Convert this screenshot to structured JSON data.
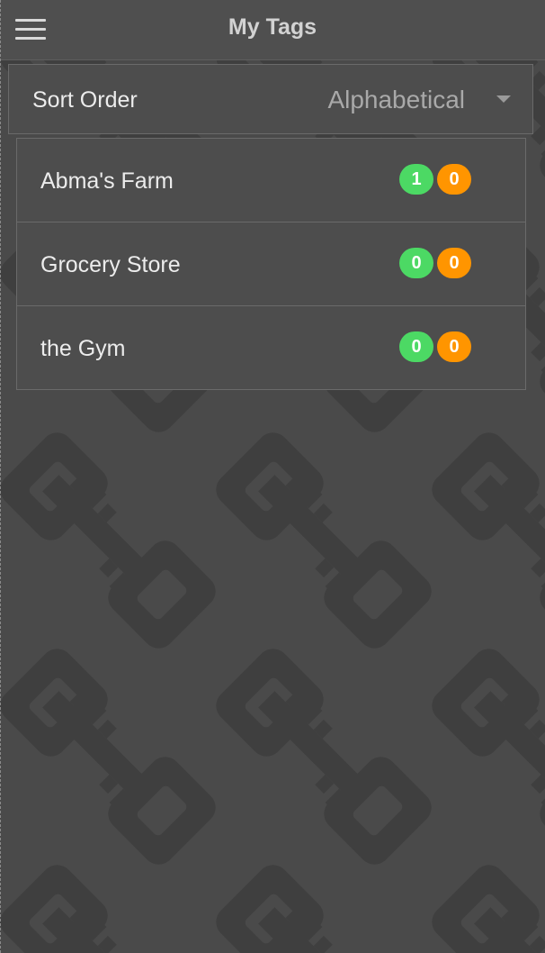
{
  "header": {
    "title": "My Tags",
    "menu_icon": "hamburger-menu-icon"
  },
  "sort": {
    "label": "Sort Order",
    "value": "Alphabetical",
    "icon": "dropdown-caret-icon"
  },
  "tags": [
    {
      "name": "Abma's Farm",
      "count_green": "1",
      "count_orange": "0"
    },
    {
      "name": "Grocery Store",
      "count_green": "0",
      "count_orange": "0"
    },
    {
      "name": "the Gym",
      "count_green": "0",
      "count_orange": "0"
    }
  ],
  "colors": {
    "badge_green": "#4cd964",
    "badge_orange": "#ff9500",
    "background": "#4a4a4a",
    "pattern_key": "#3f3f3f"
  }
}
